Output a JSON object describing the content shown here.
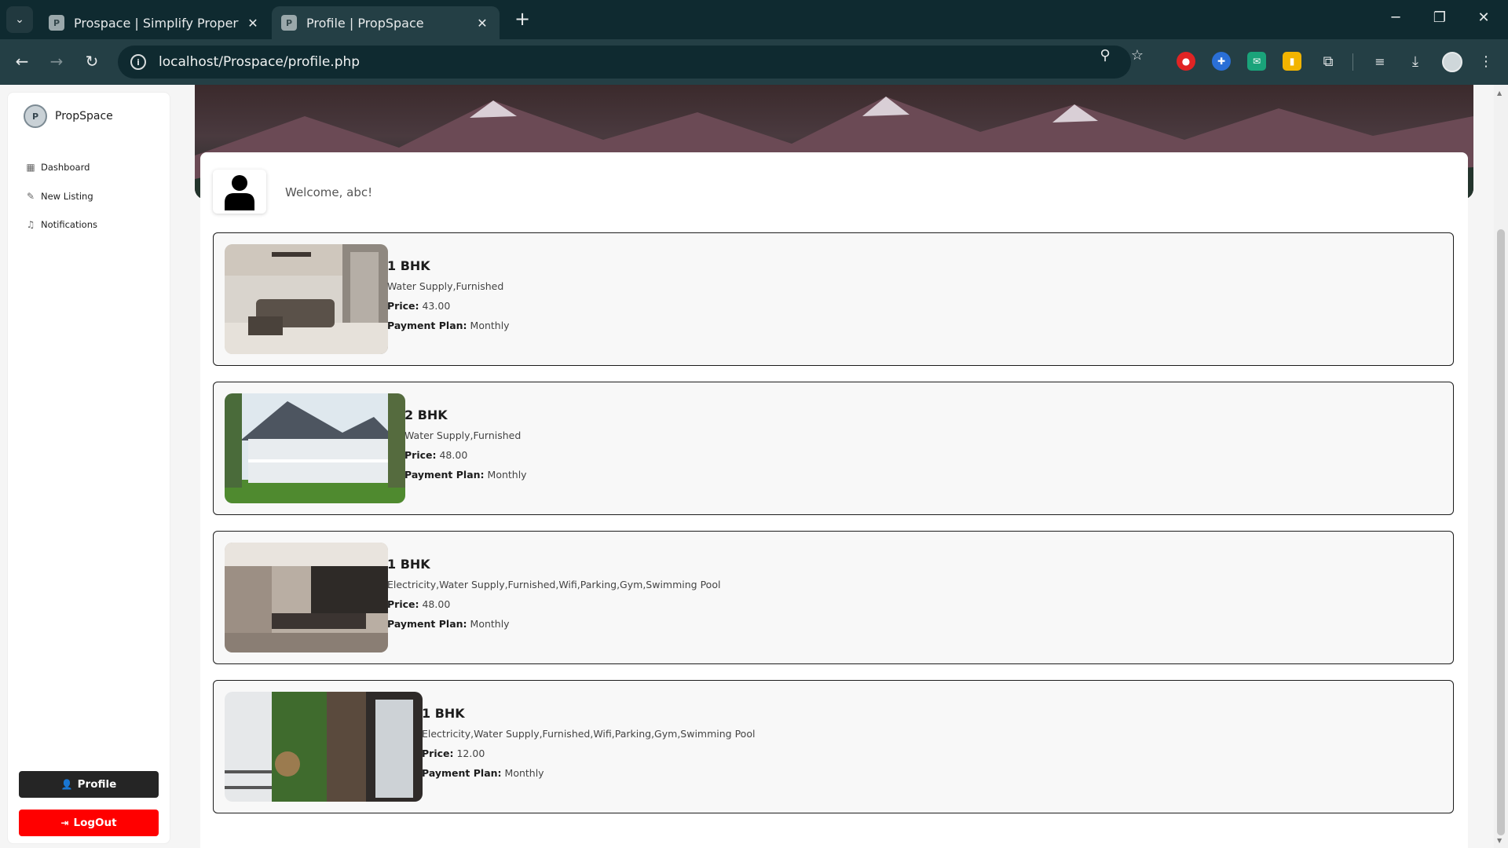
{
  "browser": {
    "tabs": [
      {
        "title": "Prospace | Simplify Property Lis",
        "active": false
      },
      {
        "title": "Profile | PropSpace",
        "active": true
      }
    ],
    "url": "localhost/Prospace/profile.php"
  },
  "sidebar": {
    "brand": "PropSpace",
    "items": [
      {
        "label": "Dashboard",
        "icon": "dashboard-icon"
      },
      {
        "label": "New Listing",
        "icon": "pencil-icon"
      },
      {
        "label": "Notifications",
        "icon": "bell-icon"
      }
    ],
    "profile_label": "Profile",
    "logout_label": "LogOut"
  },
  "main": {
    "welcome": "Welcome, abc!",
    "price_label": "Price:",
    "plan_label": "Payment Plan:",
    "listings": [
      {
        "title": "1 BHK",
        "amenities": "Water Supply,Furnished",
        "price": "43.00",
        "payment_plan": "Monthly"
      },
      {
        "title": "2 BHK",
        "amenities": "Water Supply,Furnished",
        "price": "48.00",
        "payment_plan": "Monthly"
      },
      {
        "title": "1 BHK",
        "amenities": "Electricity,Water Supply,Furnished,Wifi,Parking,Gym,Swimming Pool",
        "price": "48.00",
        "payment_plan": "Monthly"
      },
      {
        "title": "1 BHK",
        "amenities": "Electricity,Water Supply,Furnished,Wifi,Parking,Gym,Swimming Pool",
        "price": "12.00",
        "payment_plan": "Monthly"
      }
    ]
  },
  "colors": {
    "logout": "#ff0000",
    "profile_button": "#252525",
    "browser_frame": "#0f2a30"
  }
}
